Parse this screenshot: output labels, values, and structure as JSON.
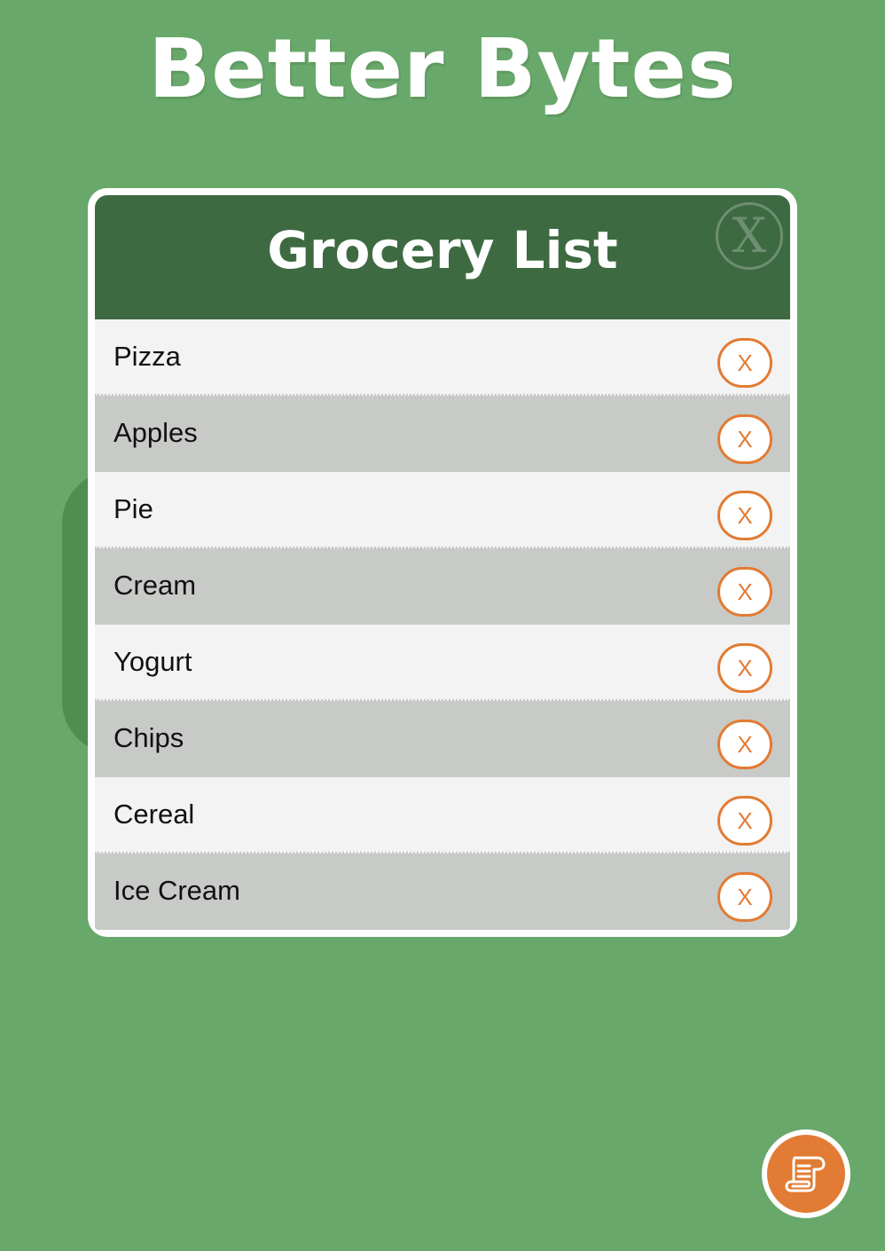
{
  "app": {
    "title": "Better Bytes"
  },
  "modal": {
    "title": "Grocery List",
    "close_label": "X"
  },
  "grocery_list": {
    "items": [
      {
        "name": "Pizza",
        "remove_label": "X"
      },
      {
        "name": "Apples",
        "remove_label": "X"
      },
      {
        "name": "Pie",
        "remove_label": "X"
      },
      {
        "name": "Cream",
        "remove_label": "X"
      },
      {
        "name": "Yogurt",
        "remove_label": "X"
      },
      {
        "name": "Chips",
        "remove_label": "X"
      },
      {
        "name": "Cereal",
        "remove_label": "X"
      },
      {
        "name": "Ice Cream",
        "remove_label": "X"
      }
    ]
  },
  "fab": {
    "icon": "scroll-list-icon"
  },
  "colors": {
    "background": "#68a86a",
    "header": "#3e6a42",
    "accent": "#e27b33",
    "row_light": "#f3f3f3",
    "row_dark": "#c8cac7"
  }
}
